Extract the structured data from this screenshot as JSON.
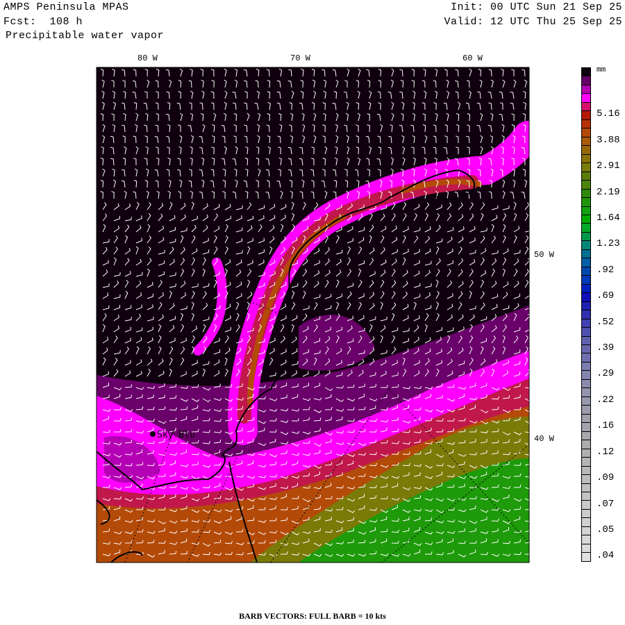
{
  "header": {
    "model": "AMPS Peninsula MPAS",
    "forecast": "Fcst:  108 h",
    "field": "Precipitable water vapor",
    "init": "Init: 00 UTC Sun 21 Sep 25",
    "valid": "Valid: 12 UTC Thu 25 Sep 25"
  },
  "axes": {
    "top_labels": [
      "80 W",
      "70 W",
      "60 W"
    ],
    "right_labels": [
      "50 W",
      "40 W"
    ]
  },
  "station": {
    "name": "Sky Blu"
  },
  "footer": "BARB VECTORS:  FULL BARB = 10 kts",
  "colorbar": {
    "unit": "mm",
    "labels": [
      "5.16",
      "3.88",
      "2.91",
      "2.19",
      "1.64",
      "1.23",
      ".92",
      ".69",
      ".52",
      ".39",
      ".29",
      ".22",
      ".16",
      ".12",
      ".09",
      ".07",
      ".05",
      ".04"
    ],
    "colors": [
      "#0c0010",
      "#660066",
      "#b400b4",
      "#ff00ff",
      "#d4106a",
      "#b41a08",
      "#b83208",
      "#b44a08",
      "#a85a08",
      "#986808",
      "#887408",
      "#787c08",
      "#5c7c08",
      "#4a840a",
      "#308a0a",
      "#1e960a",
      "#10a010",
      "#00aa00",
      "#00a828",
      "#009848",
      "#008878",
      "#007090",
      "#0060a8",
      "#0048b0",
      "#0038b8",
      "#0020c0",
      "#1010b8",
      "#2020b0",
      "#3030b0",
      "#4040b0",
      "#5050b0",
      "#6060b0",
      "#6868ac",
      "#7070b0",
      "#7c7cb0",
      "#8484b0",
      "#8c8cb0",
      "#9494b0",
      "#9898ac",
      "#9c9cac",
      "#a0a0ac",
      "#a4a4ac",
      "#a8a8ac",
      "#acacac",
      "#b0b0b0",
      "#b4b4b4",
      "#b8b8b8",
      "#bcbcbc",
      "#c0c0c0",
      "#c4c4c4",
      "#c8c8c8",
      "#cccccc",
      "#d0d0d0",
      "#d4d4d4",
      "#d8d8d8",
      "#dcdcdc",
      "#e0e0e0"
    ]
  },
  "map_colors": {
    "dry": "#10000f",
    "purple": "#6a006a",
    "violet": "#b400b4",
    "magenta": "#ff00ff",
    "red": "#c0184a",
    "orange": "#b44a08",
    "olive": "#7a7a08",
    "green": "#1e9a0a",
    "barb": "#ffffff"
  }
}
